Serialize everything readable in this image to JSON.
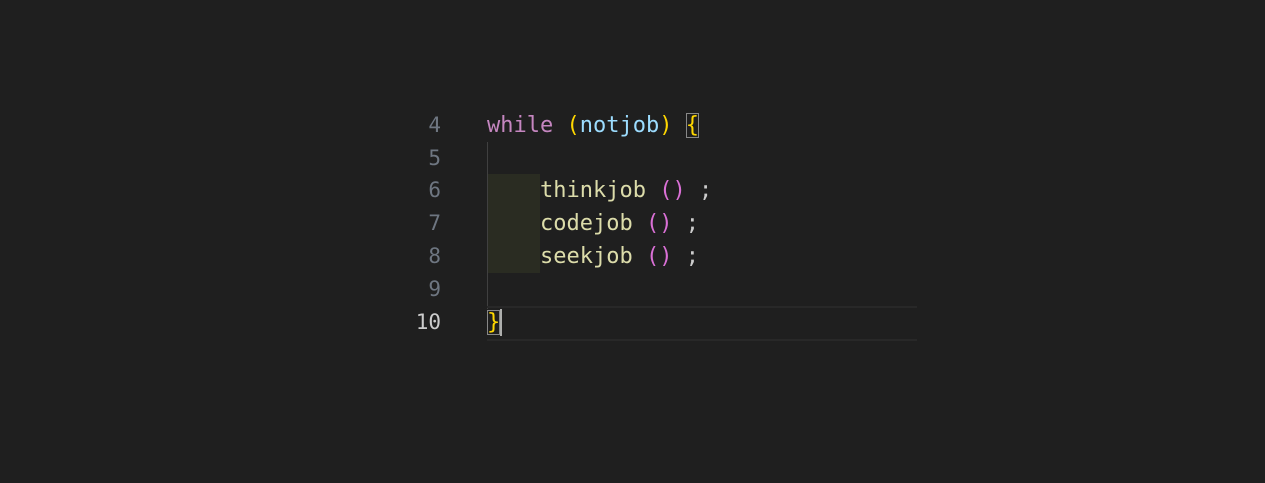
{
  "editor": {
    "lines": [
      {
        "number": "4"
      },
      {
        "number": "5"
      },
      {
        "number": "6"
      },
      {
        "number": "7"
      },
      {
        "number": "8"
      },
      {
        "number": "9"
      },
      {
        "number": "10"
      }
    ],
    "line4": {
      "keyword": "while",
      "paren_open": "(",
      "variable": "notjob",
      "paren_close": ")",
      "brace_open": "{"
    },
    "line6": {
      "call": "thinkjob",
      "parens": "()",
      "semicolon": ";"
    },
    "line7": {
      "call": "codejob",
      "parens": "()",
      "semicolon": ";"
    },
    "line8": {
      "call": "seekjob",
      "parens": "()",
      "semicolon": ";"
    },
    "line10": {
      "brace_close": "}"
    },
    "colors": {
      "background": "#1f1f1f",
      "keyword": "#c586c0",
      "bracket_level1": "#ffd700",
      "bracket_level2": "#da70d6",
      "variable": "#9cdcfe",
      "function": "#dcdcaa",
      "line_number": "#6e7681",
      "active_line_number": "#cccccc"
    }
  }
}
